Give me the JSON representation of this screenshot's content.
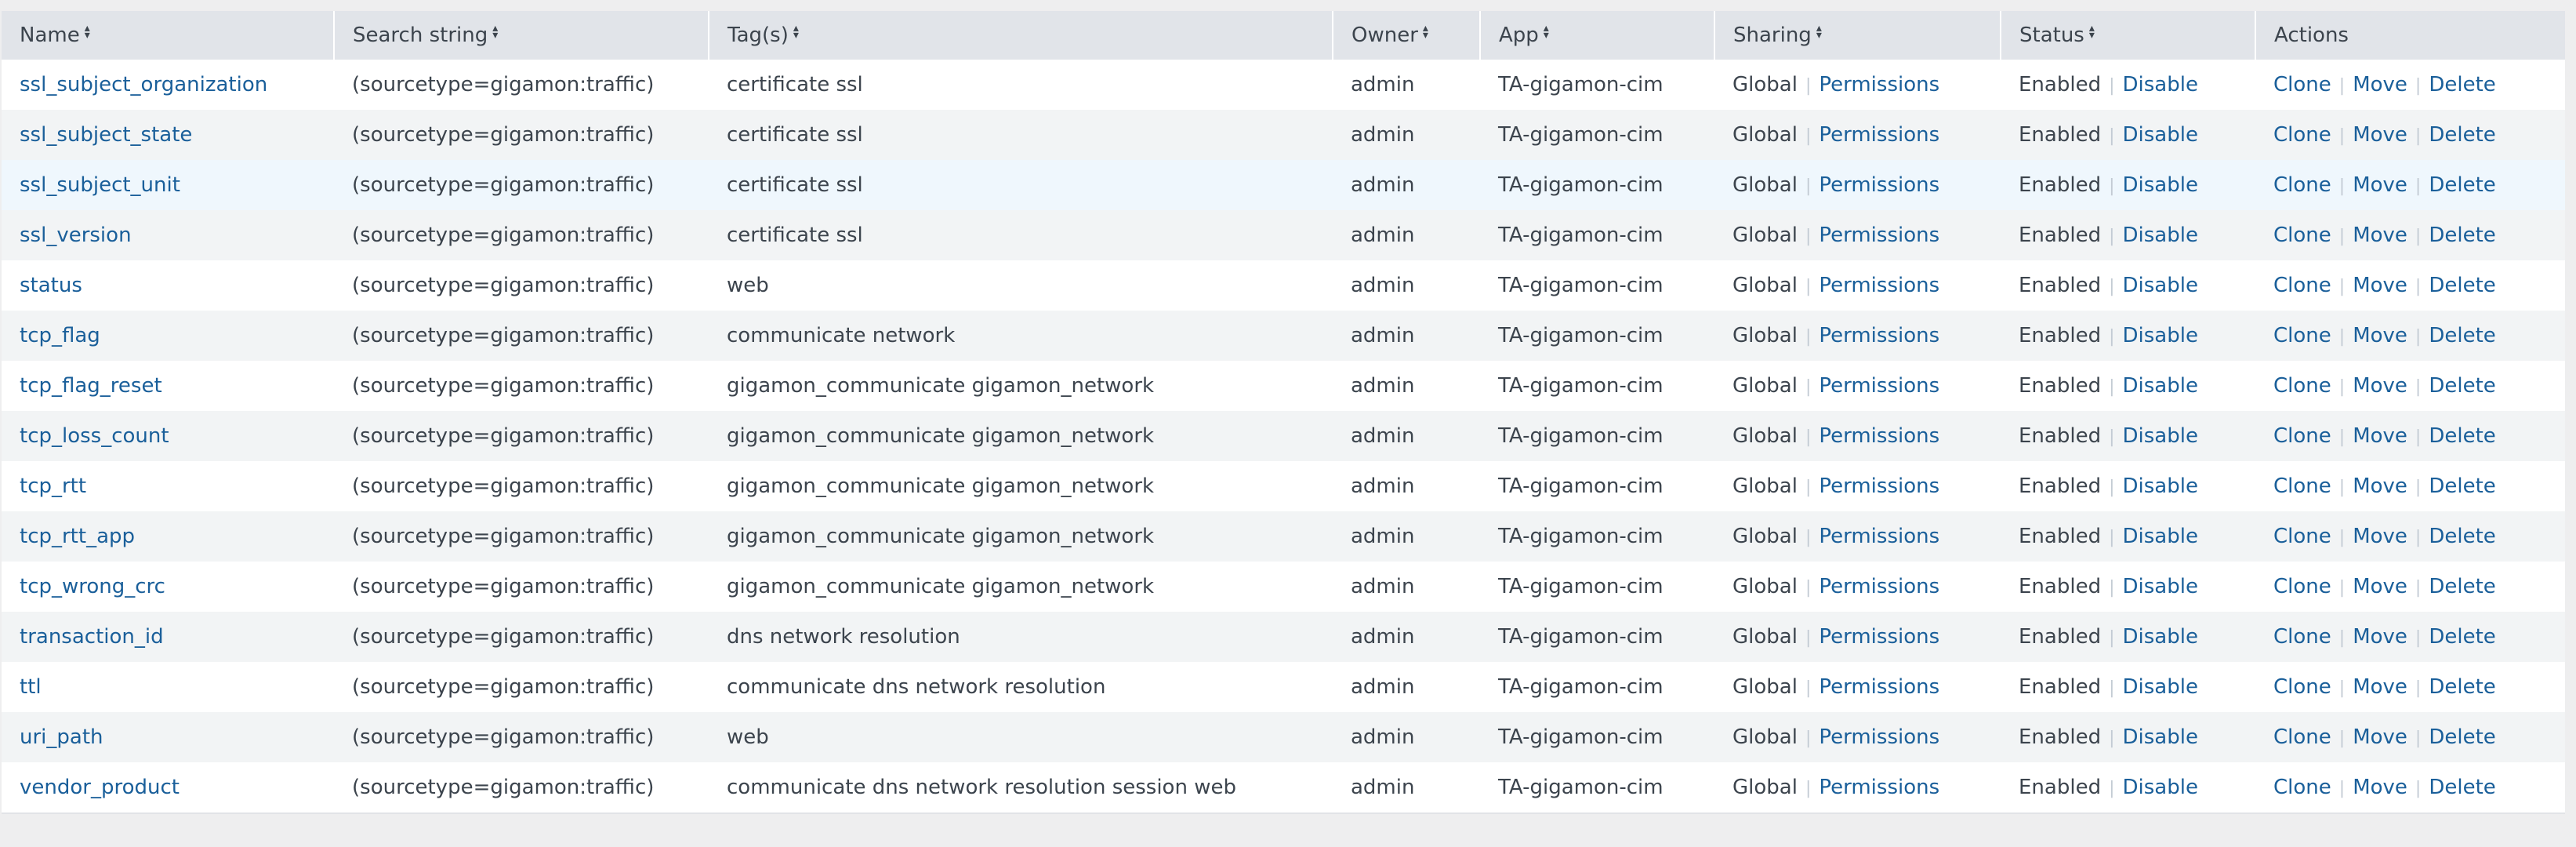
{
  "headers": {
    "name": "Name",
    "search": "Search string",
    "tags": "Tag(s)",
    "owner": "Owner",
    "app": "App",
    "sharing": "Sharing",
    "status": "Status",
    "actions": "Actions"
  },
  "labels": {
    "permissions": "Permissions",
    "disable": "Disable",
    "clone": "Clone",
    "move": "Move",
    "delete": "Delete"
  },
  "rows": [
    {
      "name": "ssl_subject_organization",
      "search": "(sourcetype=gigamon:traffic)",
      "tags": "certificate ssl",
      "owner": "admin",
      "app": "TA-gigamon-cim",
      "sharing": "Global",
      "status": "Enabled"
    },
    {
      "name": "ssl_subject_state",
      "search": "(sourcetype=gigamon:traffic)",
      "tags": "certificate ssl",
      "owner": "admin",
      "app": "TA-gigamon-cim",
      "sharing": "Global",
      "status": "Enabled"
    },
    {
      "name": "ssl_subject_unit",
      "search": "(sourcetype=gigamon:traffic)",
      "tags": "certificate ssl",
      "owner": "admin",
      "app": "TA-gigamon-cim",
      "sharing": "Global",
      "status": "Enabled"
    },
    {
      "name": "ssl_version",
      "search": "(sourcetype=gigamon:traffic)",
      "tags": "certificate ssl",
      "owner": "admin",
      "app": "TA-gigamon-cim",
      "sharing": "Global",
      "status": "Enabled"
    },
    {
      "name": "status",
      "search": "(sourcetype=gigamon:traffic)",
      "tags": "web",
      "owner": "admin",
      "app": "TA-gigamon-cim",
      "sharing": "Global",
      "status": "Enabled"
    },
    {
      "name": "tcp_flag",
      "search": "(sourcetype=gigamon:traffic)",
      "tags": "communicate network",
      "owner": "admin",
      "app": "TA-gigamon-cim",
      "sharing": "Global",
      "status": "Enabled"
    },
    {
      "name": "tcp_flag_reset",
      "search": "(sourcetype=gigamon:traffic)",
      "tags": "gigamon_communicate gigamon_network",
      "owner": "admin",
      "app": "TA-gigamon-cim",
      "sharing": "Global",
      "status": "Enabled"
    },
    {
      "name": "tcp_loss_count",
      "search": "(sourcetype=gigamon:traffic)",
      "tags": "gigamon_communicate gigamon_network",
      "owner": "admin",
      "app": "TA-gigamon-cim",
      "sharing": "Global",
      "status": "Enabled"
    },
    {
      "name": "tcp_rtt",
      "search": "(sourcetype=gigamon:traffic)",
      "tags": "gigamon_communicate gigamon_network",
      "owner": "admin",
      "app": "TA-gigamon-cim",
      "sharing": "Global",
      "status": "Enabled"
    },
    {
      "name": "tcp_rtt_app",
      "search": "(sourcetype=gigamon:traffic)",
      "tags": "gigamon_communicate gigamon_network",
      "owner": "admin",
      "app": "TA-gigamon-cim",
      "sharing": "Global",
      "status": "Enabled"
    },
    {
      "name": "tcp_wrong_crc",
      "search": "(sourcetype=gigamon:traffic)",
      "tags": "gigamon_communicate gigamon_network",
      "owner": "admin",
      "app": "TA-gigamon-cim",
      "sharing": "Global",
      "status": "Enabled"
    },
    {
      "name": "transaction_id",
      "search": "(sourcetype=gigamon:traffic)",
      "tags": "dns network resolution",
      "owner": "admin",
      "app": "TA-gigamon-cim",
      "sharing": "Global",
      "status": "Enabled"
    },
    {
      "name": "ttl",
      "search": "(sourcetype=gigamon:traffic)",
      "tags": "communicate dns network resolution",
      "owner": "admin",
      "app": "TA-gigamon-cim",
      "sharing": "Global",
      "status": "Enabled"
    },
    {
      "name": "uri_path",
      "search": "(sourcetype=gigamon:traffic)",
      "tags": "web",
      "owner": "admin",
      "app": "TA-gigamon-cim",
      "sharing": "Global",
      "status": "Enabled"
    },
    {
      "name": "vendor_product",
      "search": "(sourcetype=gigamon:traffic)",
      "tags": "communicate dns network resolution session web",
      "owner": "admin",
      "app": "TA-gigamon-cim",
      "sharing": "Global",
      "status": "Enabled"
    }
  ],
  "colors": {
    "link": "#1a5f9a",
    "text": "#3c444d",
    "header_bg": "#e1e4e9",
    "row_alt_bg": "#f2f4f5",
    "row_hover_bg": "#eff7fd"
  }
}
